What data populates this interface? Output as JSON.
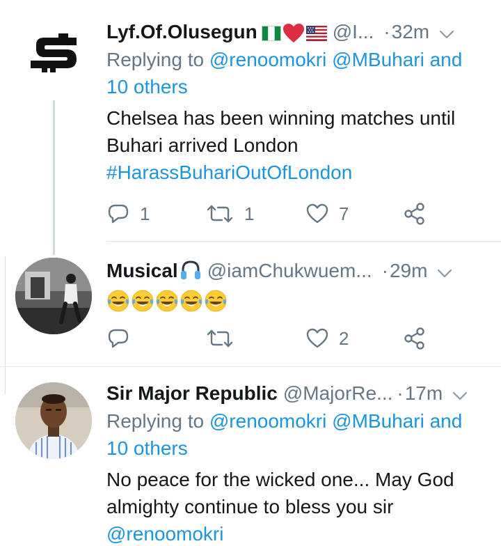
{
  "tweets": [
    {
      "author_name": "Lyf.Of.Olusegun",
      "author_badges": [
        "flag-nigeria",
        "red-heart",
        "flag-usa"
      ],
      "handle": "@I...",
      "time": "32m",
      "replying_prefix": "Replying to ",
      "replying_to": [
        "@renoomokri",
        "@MBuhari"
      ],
      "replying_and": " and",
      "replying_others": "10 others",
      "text": "Chelsea has been winning matches until Buhari arrived London",
      "hashtag": "#HarassBuhariOutOfLondon",
      "counts": {
        "replies": "1",
        "retweets": "1",
        "likes": "7"
      }
    },
    {
      "author_name": "Musical",
      "author_badges": [
        "headphone"
      ],
      "handle": "@iamChukwuem...",
      "time": "29m",
      "emoji_text": [
        "face-with-tears-of-joy",
        "face-with-tears-of-joy",
        "face-with-tears-of-joy",
        "face-with-tears-of-joy",
        "face-with-tears-of-joy"
      ],
      "counts": {
        "replies": "",
        "retweets": "",
        "likes": "2"
      }
    },
    {
      "author_name": "Sir Major Republic",
      "handle": "@MajorRe...",
      "time": "17m",
      "replying_prefix": "Replying to ",
      "replying_to": [
        "@renoomokri",
        "@MBuhari"
      ],
      "replying_and": " and",
      "replying_others": "10 others",
      "text": "No peace for the wicked one... May God almighty continue to bless you sir",
      "mention": "@renoomokri"
    }
  ],
  "separator": " · ",
  "colors": {
    "link": "#1b95e0",
    "secondary_text": "#657786",
    "primary_text": "#14171a",
    "divider": "#e1e8ed",
    "emoji_yellow": "#ffcc33"
  },
  "icons": [
    "reply-icon",
    "retweet-icon",
    "like-icon",
    "share-icon",
    "caret-down-icon"
  ]
}
